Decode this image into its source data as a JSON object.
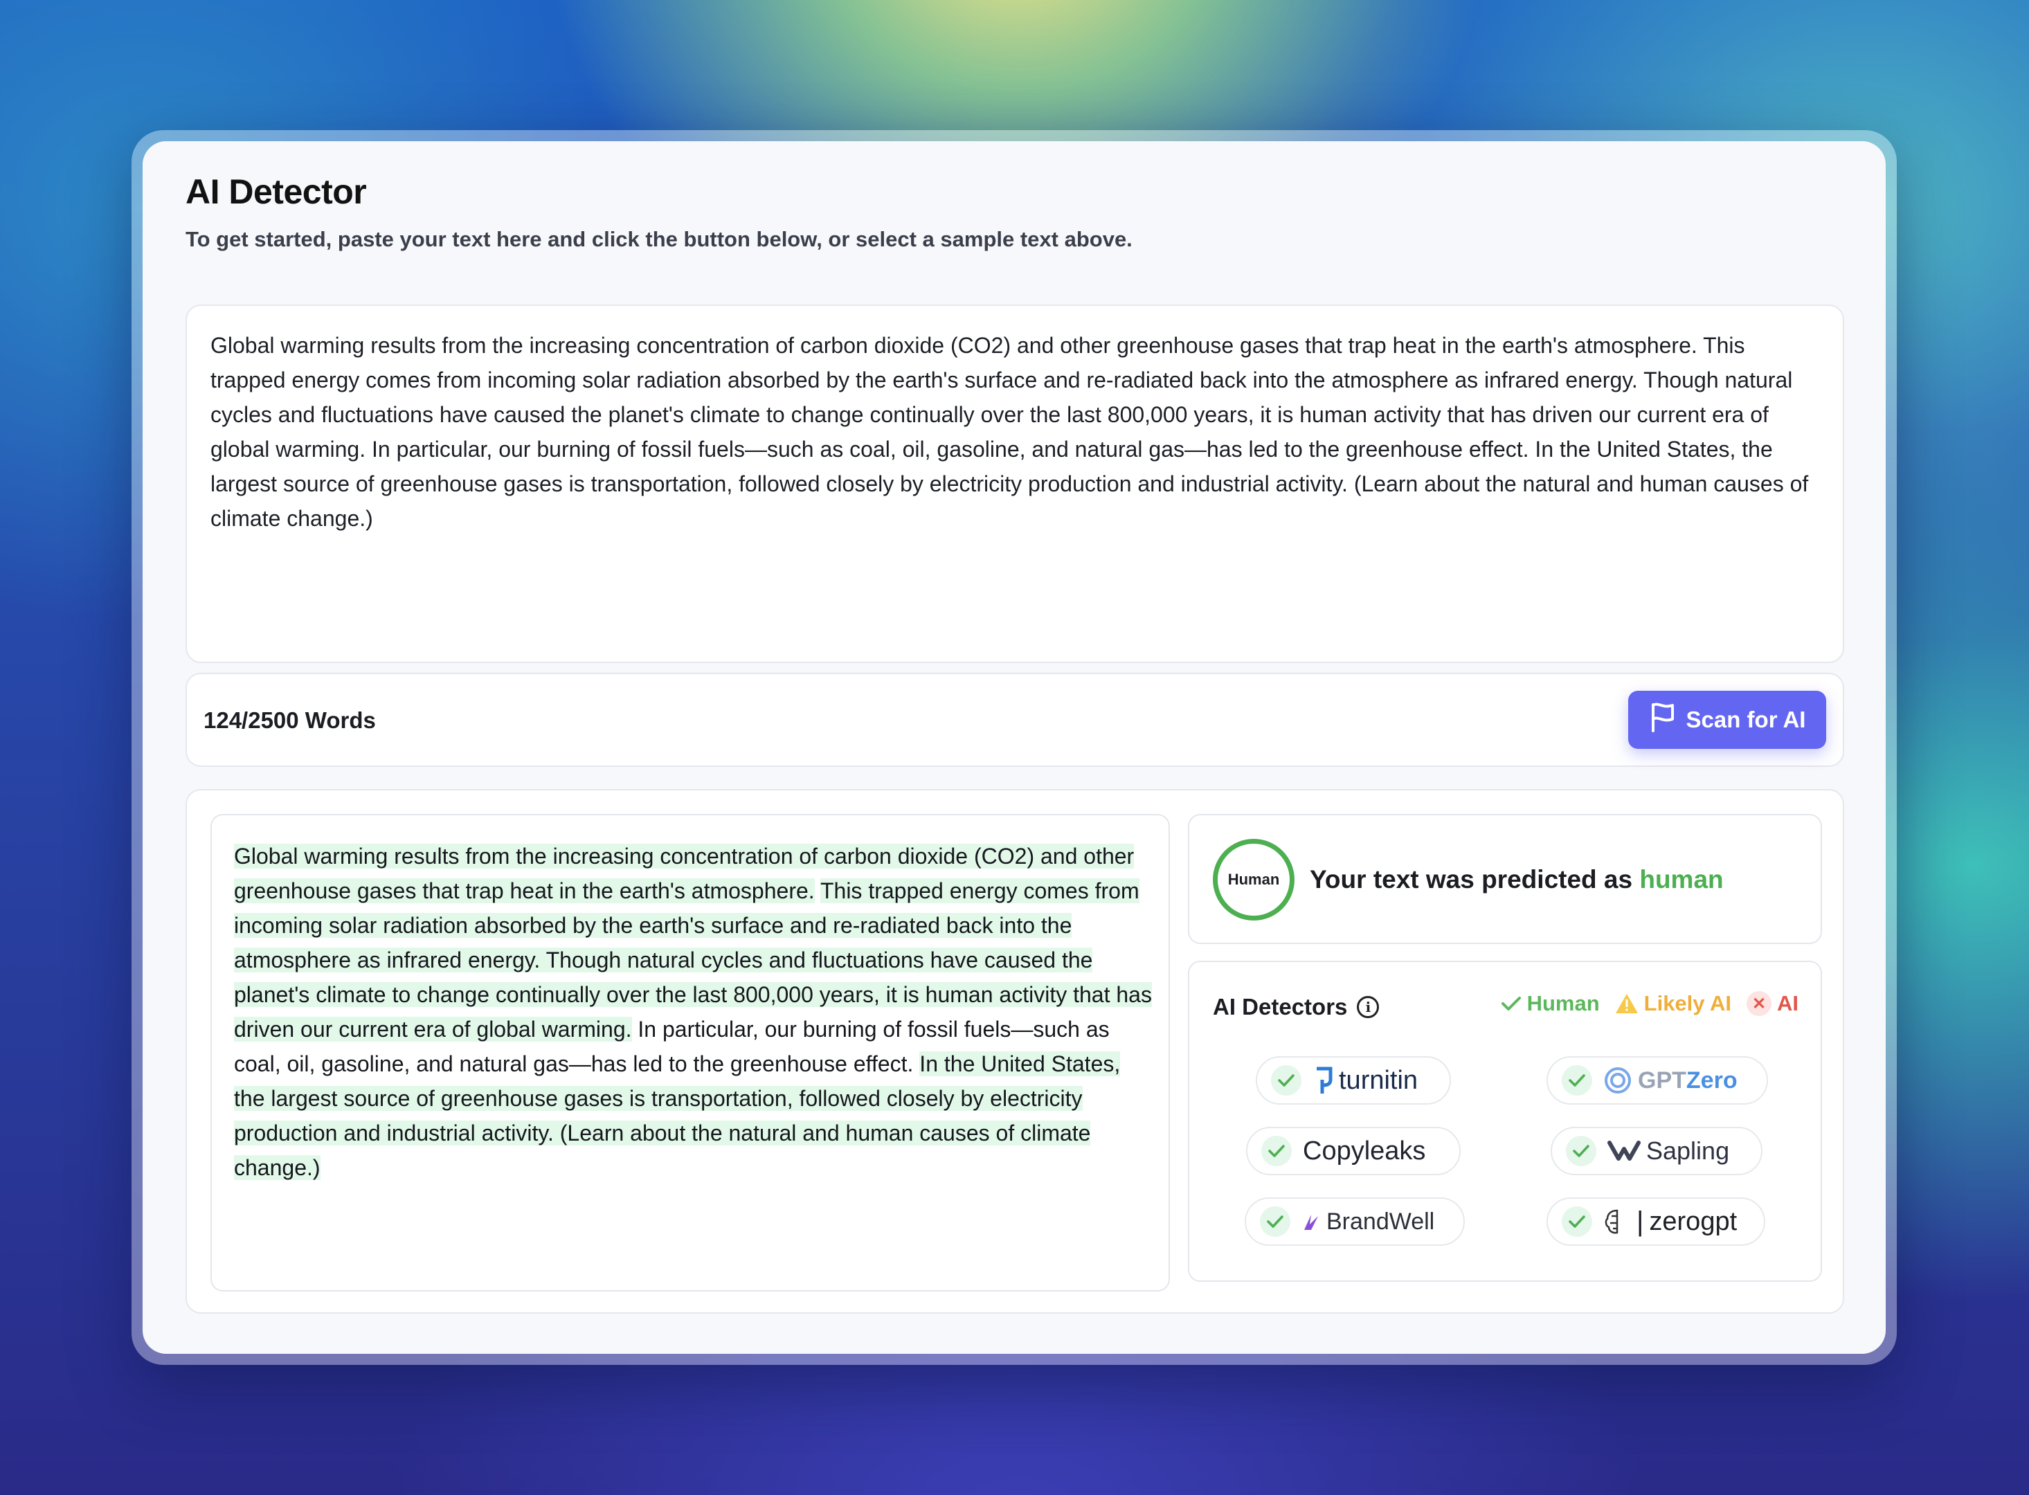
{
  "app": {
    "title": "AI Detector",
    "subtitle": "To get started, paste your text here and click the button below, or select a sample text above."
  },
  "input": {
    "text": "Global warming results from the increasing concentration of carbon dioxide (CO2) and other greenhouse gases that trap heat in the earth's atmosphere. This trapped energy comes from incoming solar radiation absorbed by the earth's surface and re-radiated back into the atmosphere as infrared energy. Though natural cycles and fluctuations have caused the planet's climate to change continually over the last 800,000 years, it is human activity that has driven our current era of global warming. In particular, our burning of fossil fuels—such as coal, oil, gasoline, and natural gas—has led to the greenhouse effect. In the United States, the largest source of greenhouse gases is transportation, followed closely by electricity production and industrial activity. (Learn about the natural and human causes of climate change.)"
  },
  "toolbar": {
    "word_count": "124/2500 Words",
    "scan_label": "Scan for AI"
  },
  "result": {
    "segments": [
      {
        "text": "Global warming results from the increasing concentration of carbon dioxide (CO2) and other greenhouse gases that trap heat in the earth's atmosphere.",
        "highlight": true
      },
      {
        "text": " ",
        "highlight": false
      },
      {
        "text": "This trapped energy comes from incoming solar radiation absorbed by the earth's surface and re-radiated back into the atmosphere as infrared energy. Though natural cycles and fluctuations have caused the planet's climate to change continually over the last 800,000 years, it is human activity that has driven our current era of global warming.",
        "highlight": true
      },
      {
        "text": " In particular, our burning of fossil fuels—such as coal, oil, gasoline, and natural gas—has led to the greenhouse effect. ",
        "highlight": false
      },
      {
        "text": "In the United States, the largest source of greenhouse gases is transportation, followed closely by electricity production and industrial activity. (Learn about the natural and human causes of climate change.)",
        "highlight": true
      }
    ],
    "badge": "Human",
    "verdict_prefix": "Your text was predicted as",
    "verdict_value": "human"
  },
  "detectors": {
    "title": "AI Detectors",
    "legend": {
      "human": "Human",
      "likely_ai": "Likely AI",
      "ai": "AI"
    },
    "items": [
      {
        "name": "turnitin",
        "status": "human"
      },
      {
        "name": "GPT",
        "suffix": "Zero",
        "status": "human"
      },
      {
        "name": "Copyleaks",
        "status": "human"
      },
      {
        "name": "Sapling",
        "status": "human"
      },
      {
        "name": "BrandWell",
        "status": "human"
      },
      {
        "name": "zerogpt",
        "status": "human"
      }
    ]
  },
  "colors": {
    "accent": "#6366f1",
    "human": "#4caf50",
    "likely_ai": "#f0ad3a",
    "ai": "#e2574c",
    "highlight": "#e2f8e9"
  }
}
